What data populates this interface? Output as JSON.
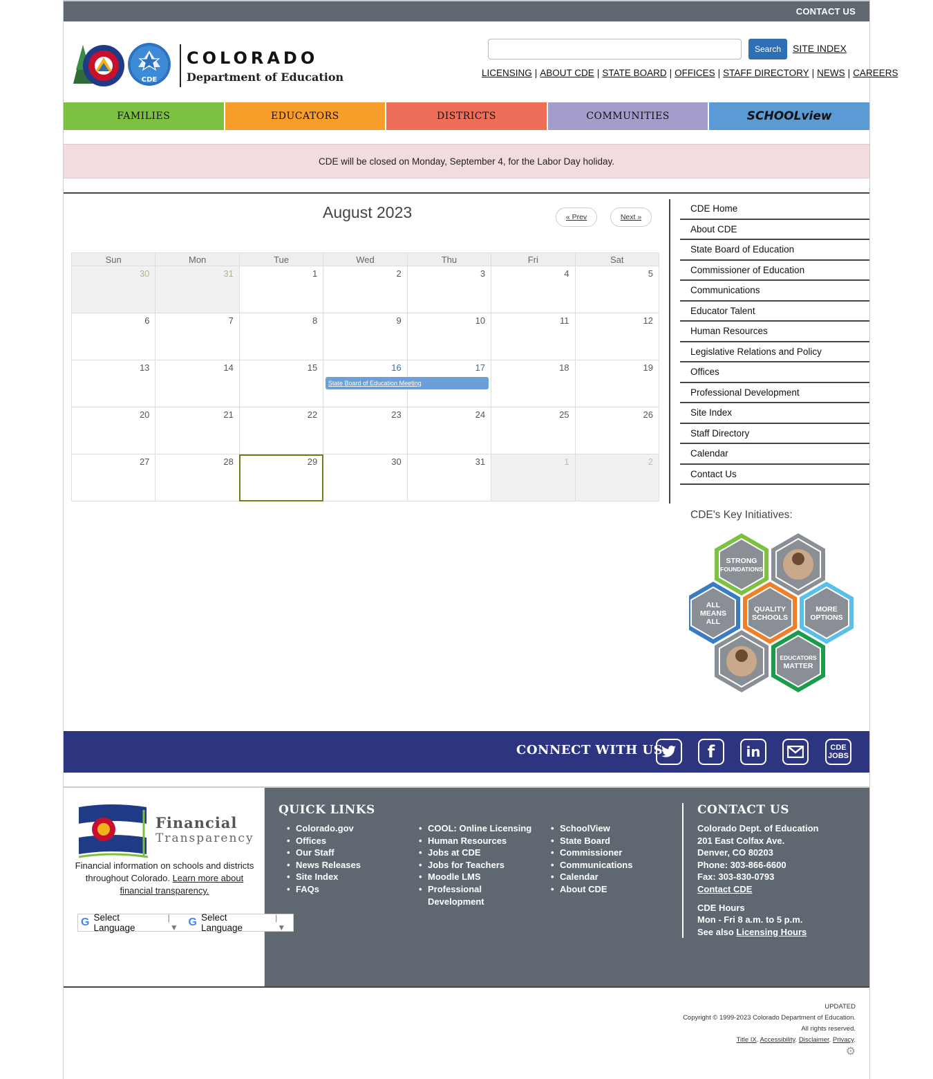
{
  "topbar": {
    "contact": "CONTACT US"
  },
  "header": {
    "logo_title": "COLORADO",
    "logo_sub": "Department of Education",
    "logo_badge": "CDE",
    "search_button": "Search",
    "search_placeholder": "",
    "site_index": "SITE INDEX",
    "util_links": [
      "LICENSING",
      "ABOUT CDE",
      "STATE BOARD",
      "OFFICES",
      "STAFF DIRECTORY",
      "NEWS",
      "CAREERS"
    ]
  },
  "nav": [
    {
      "label": "FAMILIES",
      "color": "#7dc142"
    },
    {
      "label": "EDUCATORS",
      "color": "#f99d2a"
    },
    {
      "label": "DISTRICTS",
      "color": "#ee6e5a"
    },
    {
      "label": "COMMUNITIES",
      "color": "#a39dcc"
    },
    {
      "label": "SCHOOLview",
      "color": "#5b9bd5"
    }
  ],
  "alert": "CDE will be closed on Monday, September 4, for the Labor Day holiday.",
  "calendar": {
    "title": "August 2023",
    "prev": "« Prev",
    "next": "Next »",
    "days": [
      "Sun",
      "Mon",
      "Tue",
      "Wed",
      "Thu",
      "Fri",
      "Sat"
    ],
    "weeks": [
      [
        "30",
        "31",
        "1",
        "2",
        "3",
        "4",
        "5"
      ],
      [
        "6",
        "7",
        "8",
        "9",
        "10",
        "11",
        "12"
      ],
      [
        "13",
        "14",
        "15",
        "16",
        "17",
        "18",
        "19"
      ],
      [
        "20",
        "21",
        "22",
        "23",
        "24",
        "25",
        "26"
      ],
      [
        "27",
        "28",
        "29",
        "30",
        "31",
        "1",
        "2"
      ]
    ],
    "event": "State Board of Education Meeting"
  },
  "side_menu": [
    "CDE Home",
    "About CDE",
    "State Board of Education",
    "Commissioner of Education",
    "Communications",
    "Educator Talent",
    "Human Resources",
    "Legislative Relations and Policy",
    "Offices",
    "Professional Development",
    "Site Index",
    "Staff Directory",
    "Calendar",
    "Contact Us"
  ],
  "key_initiatives": {
    "title": "CDE's Key Initiatives:",
    "hexes": [
      {
        "label1": "STRONG",
        "label2": "FOUNDATIONS",
        "label3": "",
        "color": "#7dc142"
      },
      {
        "label1": "",
        "label2": "",
        "label3": "",
        "color": "#8a8f96"
      },
      {
        "label1": "ALL",
        "label2": "MEANS",
        "label3": "ALL",
        "color": "#3a7cc2"
      },
      {
        "label1": "QUALITY",
        "label2": "SCHOOLS",
        "label3": "",
        "color": "#f07f2a"
      },
      {
        "label1": "MORE",
        "label2": "OPTIONS",
        "label3": "",
        "color": "#5bc0e8"
      },
      {
        "label1": "",
        "label2": "",
        "label3": "",
        "color": "#8a8f96"
      },
      {
        "label1": "EDUCATORS",
        "label2": "MATTER",
        "label3": "",
        "color": "#1e9a4b"
      }
    ]
  },
  "connect": {
    "label": "CONNECT WITH US",
    "icons": [
      "twitter-icon",
      "facebook-icon",
      "linkedin-icon",
      "email-icon",
      "cde-jobs-icon"
    ],
    "jobs1": "CDE",
    "jobs2": "JOBS"
  },
  "footer": {
    "fin_title": "Financial",
    "fin_sub": "Transparency",
    "fin_text": "Financial information on schools and districts throughout Colorado.",
    "fin_link": "Learn more about financial transparency.",
    "lang1": "Select Language",
    "lang2": "Select Language",
    "quick_links_title": "QUICK LINKS",
    "col1": [
      "Colorado.gov",
      "Offices",
      "Our Staff",
      "News Releases",
      "Site Index",
      "FAQs"
    ],
    "col2": [
      "COOL: Online Licensing",
      "Human Resources",
      "Jobs at CDE",
      "Jobs for Teachers",
      "Moodle LMS",
      "Professional Development"
    ],
    "col3": [
      "SchoolView",
      "State Board",
      "Commissioner",
      "Communications",
      "Calendar",
      "About CDE"
    ],
    "contact_title": "CONTACT US",
    "contact_lines": [
      "Colorado Dept. of Education",
      "201 East Colfax Ave.",
      "Denver, CO 80203",
      "Phone: 303-866-6600",
      "Fax: 303-830-0793"
    ],
    "contact_link": "Contact CDE",
    "hours_title": "CDE Hours",
    "hours": "Mon - Fri 8 a.m. to 5 p.m.",
    "see_also": "See also",
    "licensing_hours": "Licensing Hours"
  },
  "bottom": {
    "updated": "UPDATED",
    "copyright": "Copyright © 1999-2023 Colorado Department of Education.",
    "rights": "All rights reserved.",
    "links": [
      "Title IX",
      "Accessibility",
      "Disclaimer",
      "Privacy"
    ]
  }
}
